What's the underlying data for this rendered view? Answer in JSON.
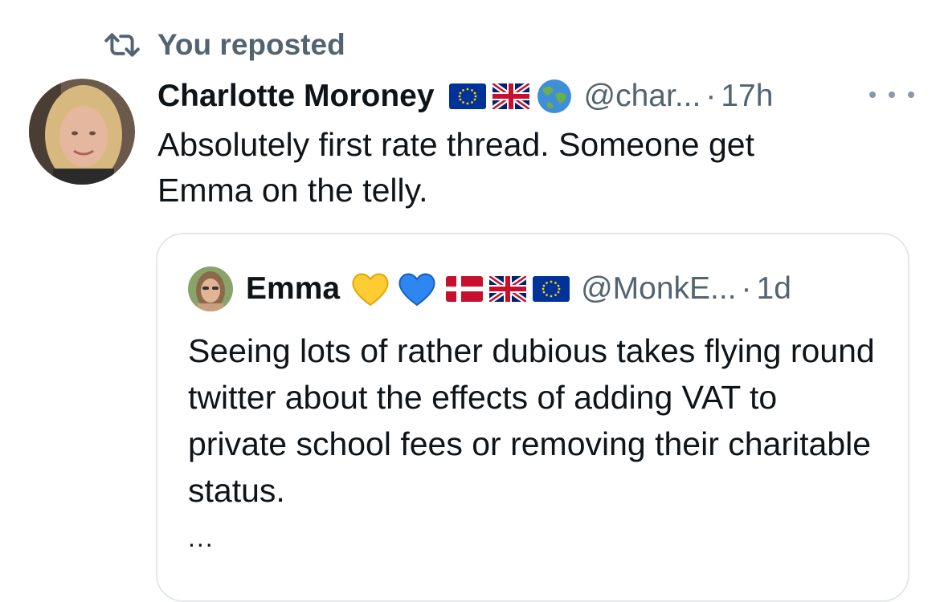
{
  "repost": {
    "label": "You reposted",
    "icon": "repost-icon"
  },
  "tweet": {
    "author_name": "Charlotte Moroney",
    "badges": [
      "eu-flag-icon",
      "uk-flag-icon",
      "globe-icon"
    ],
    "handle": "@char...",
    "separator": "·",
    "time": "17h",
    "text": "Absolutely first rate thread. Someone get\nEmma on the telly."
  },
  "quoted": {
    "author_name": "Emma",
    "badges": [
      "yellow-heart-icon",
      "blue-heart-icon",
      "denmark-flag-icon",
      "uk-flag-icon",
      "eu-flag-icon"
    ],
    "handle": "@MonkE...",
    "separator": "·",
    "time": "1d",
    "text": "Seeing lots of rather dubious takes flying round twitter about the effects of adding VAT to private school fees or removing their charitable status.",
    "truncation": "..."
  },
  "colors": {
    "text": "#0f1419",
    "secondary": "#536471",
    "border": "#e3e8ec",
    "eu_blue": "#003399",
    "eu_gold": "#ffcc00"
  }
}
